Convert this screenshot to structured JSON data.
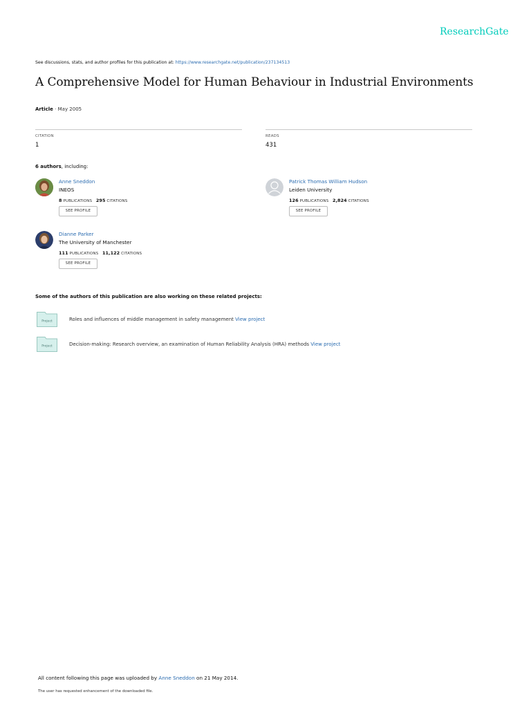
{
  "brand": {
    "logo_text": "ResearchGate",
    "color": "#00ccbb"
  },
  "discussion": {
    "prefix": "See discussions, stats, and author profiles for this publication at: ",
    "url": "https://www.researchgate.net/publication/237134513"
  },
  "publication": {
    "title": "A Comprehensive Model for Human Behaviour in Industrial Environments",
    "type": "Article",
    "date_sep": " · ",
    "date": "May 2005"
  },
  "stats": {
    "citation_label": "CITATION",
    "citation_value": "1",
    "reads_label": "READS",
    "reads_value": "431"
  },
  "authors_heading": {
    "count": "6 authors",
    "suffix": ", including:"
  },
  "authors": [
    {
      "name": "Anne Sneddon",
      "institution": "INEOS",
      "publications": "8",
      "publications_label": "PUBLICATIONS",
      "citations": "295",
      "citations_label": "CITATIONS",
      "button": "SEE PROFILE",
      "avatar_icon": "author-photo-icon"
    },
    {
      "name": "Patrick Thomas William Hudson",
      "institution": "Leiden University",
      "publications": "126",
      "publications_label": "PUBLICATIONS",
      "citations": "2,824",
      "citations_label": "CITATIONS",
      "button": "SEE PROFILE",
      "avatar_icon": "default-avatar-icon"
    },
    {
      "name": "Dianne Parker",
      "institution": "The University of Manchester",
      "publications": "111",
      "publications_label": "PUBLICATIONS",
      "citations": "11,122",
      "citations_label": "CITATIONS",
      "button": "SEE PROFILE",
      "avatar_icon": "author-photo-icon"
    }
  ],
  "projects_heading": "Some of the authors of this publication are also working on these related projects:",
  "projects": [
    {
      "icon_label": "Project",
      "text": "Roles and influences of middle management in safety management",
      "link": "View project"
    },
    {
      "icon_label": "Project",
      "text": "Decision-making: Research overview, an examination of Human Reliability Analysis (HRA) methods",
      "link": "View project"
    }
  ],
  "footer": {
    "uploaded_prefix": "All content following this page was uploaded by ",
    "uploader": "Anne Sneddon",
    "uploaded_suffix": " on 21 May 2014.",
    "enhancement_note": "The user has requested enhancement of the downloaded file."
  }
}
